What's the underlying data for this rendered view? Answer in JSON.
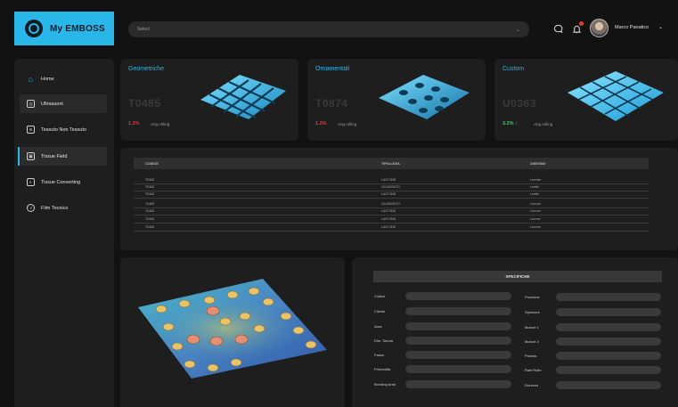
{
  "header": {
    "app_name": "My EMBOSS",
    "search_placeholder": "Select",
    "user_name": "Marco Panatico"
  },
  "sidebar": {
    "items": [
      {
        "label": "Home",
        "icon": "home-icon"
      },
      {
        "label": "Ultrasuoni",
        "icon": "ultrasound-icon"
      },
      {
        "label": "Tessuto Non Tessuto",
        "icon": "fabric-icon"
      },
      {
        "label": "Tissue Field",
        "icon": "tissue-icon"
      },
      {
        "label": "Tissue Converting",
        "icon": "converting-icon"
      },
      {
        "label": "Film Tecnico",
        "icon": "film-icon"
      }
    ],
    "active_index": 3
  },
  "cards": [
    {
      "title": "Geometriche",
      "code": "T0485",
      "stat": "1.2%",
      "sub": "Ang rolling",
      "trend": "down"
    },
    {
      "title": "Ornamentali",
      "code": "T0874",
      "stat": "1.2%",
      "sub": "Ang rolling",
      "trend": "down"
    },
    {
      "title": "Custom",
      "code": "U0363",
      "stat": "3.2% ↑",
      "sub": "Ang rolling",
      "trend": "up"
    }
  ],
  "table": {
    "headers": [
      "CODICE",
      "TIPOLOGIA",
      "DISEGNO"
    ],
    "rows": [
      [
        "T0485",
        "LASTONE",
        "Leonise"
      ],
      [
        "T0485",
        "CILINDRATO",
        "Leville"
      ],
      [
        "T0485",
        "LASTONE",
        "Leville"
      ],
      [
        "T0485",
        "CILINDRATO",
        "Leonne"
      ],
      [
        "T0485",
        "LASTONE",
        "Leonne"
      ],
      [
        "T0485",
        "LASTONE",
        "Leonne"
      ],
      [
        "T0485",
        "LASTONE",
        "Leonne"
      ]
    ]
  },
  "specs": {
    "title": "SPECIFICHE",
    "left_labels": [
      "Codice",
      "Cliente",
      "Area",
      "Dim. Tavola",
      "Passo",
      "Profondità",
      "Bonding Area"
    ],
    "right_labels": [
      "Punzione",
      "Spessore",
      "Motore 1",
      "Motore 2",
      "Portata",
      "Rast Rullo",
      "Durezza"
    ]
  },
  "colors": {
    "accent": "#29b6e8",
    "negative": "#e53935",
    "positive": "#43c96b",
    "panel": "#1e1e1e",
    "background": "#121212"
  }
}
